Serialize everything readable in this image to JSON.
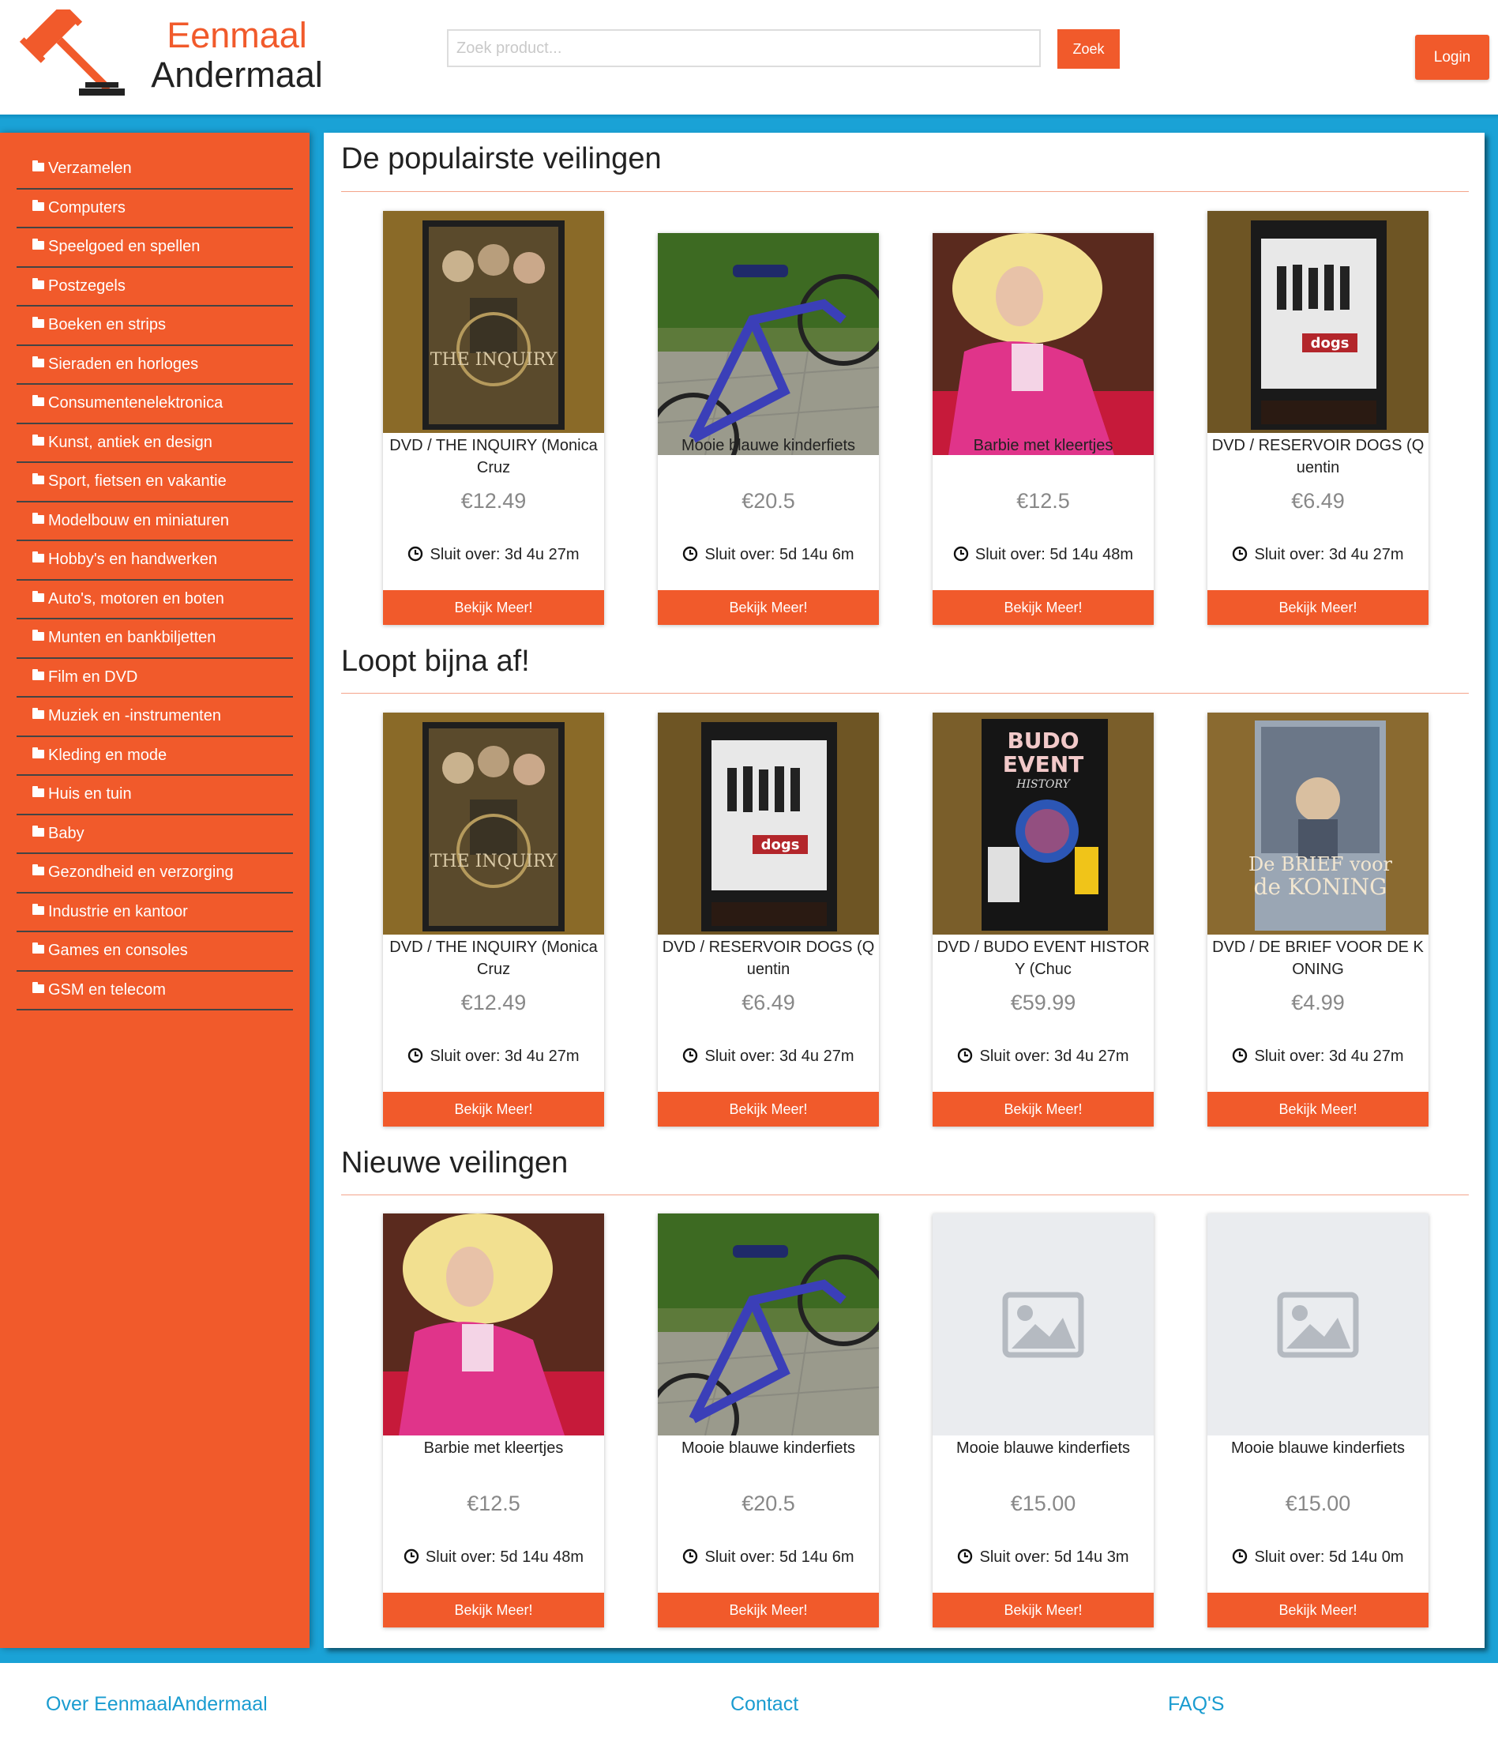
{
  "brand": {
    "line1": "Eenmaal",
    "line2": "Andermaal",
    "logo_icon": "gavel-icon"
  },
  "search": {
    "placeholder": "Zoek product...",
    "value": "",
    "button": "Zoek"
  },
  "login": "Login",
  "categories": [
    "Verzamelen",
    "Computers",
    "Speelgoed en spellen",
    "Postzegels",
    "Boeken en strips",
    "Sieraden en horloges",
    "Consumentenelektronica",
    "Kunst, antiek en design",
    "Sport, fietsen en vakantie",
    "Modelbouw en miniaturen",
    "Hobby's en handwerken",
    "Auto's, motoren en boten",
    "Munten en bankbiljetten",
    "Film en DVD",
    "Muziek en -instrumenten",
    "Kleding en mode",
    "Huis en tuin",
    "Baby",
    "Gezondheid en verzorging",
    "Industrie en kantoor",
    "Games en consoles",
    "GSM en telecom"
  ],
  "sections": [
    {
      "title": "De populairste veilingen",
      "cards": [
        {
          "title": "DVD / THE INQUIRY (Monica Cruz",
          "price": "€12.49",
          "close_label": "Sluit over:",
          "close_time": "3d 4u 27m",
          "button": "Bekijk Meer!",
          "image": "dvd-inquiry"
        },
        {
          "title": "Mooie blauwe kinderfiets",
          "price": "€20.5",
          "close_label": "Sluit over:",
          "close_time": "5d 14u 6m",
          "button": "Bekijk Meer!",
          "image": "bike"
        },
        {
          "title": "Barbie met kleertjes",
          "price": "€12.5",
          "close_label": "Sluit over:",
          "close_time": "5d 14u 48m",
          "button": "Bekijk Meer!",
          "image": "barbie"
        },
        {
          "title": "DVD / RESERVOIR DOGS (Quentin",
          "price": "€6.49",
          "close_label": "Sluit over:",
          "close_time": "3d 4u 27m",
          "button": "Bekijk Meer!",
          "image": "dvd-reservoir"
        }
      ]
    },
    {
      "title": "Loopt bijna af!",
      "cards": [
        {
          "title": "DVD / THE INQUIRY (Monica Cruz",
          "price": "€12.49",
          "close_label": "Sluit over:",
          "close_time": "3d 4u 27m",
          "button": "Bekijk Meer!",
          "image": "dvd-inquiry"
        },
        {
          "title": "DVD / RESERVOIR DOGS (Quentin",
          "price": "€6.49",
          "close_label": "Sluit over:",
          "close_time": "3d 4u 27m",
          "button": "Bekijk Meer!",
          "image": "dvd-reservoir"
        },
        {
          "title": "DVD / BUDO EVENT HISTORY (Chuc",
          "price": "€59.99",
          "close_label": "Sluit over:",
          "close_time": "3d 4u 27m",
          "button": "Bekijk Meer!",
          "image": "dvd-budo"
        },
        {
          "title": "DVD / DE BRIEF VOOR DE KONING",
          "price": "€4.99",
          "close_label": "Sluit over:",
          "close_time": "3d 4u 27m",
          "button": "Bekijk Meer!",
          "image": "dvd-brief"
        }
      ]
    },
    {
      "title": "Nieuwe veilingen",
      "cards": [
        {
          "title": "Barbie met kleertjes",
          "price": "€12.5",
          "close_label": "Sluit over:",
          "close_time": "5d 14u 48m",
          "button": "Bekijk Meer!",
          "image": "barbie"
        },
        {
          "title": "Mooie blauwe kinderfiets",
          "price": "€20.5",
          "close_label": "Sluit over:",
          "close_time": "5d 14u 6m",
          "button": "Bekijk Meer!",
          "image": "bike"
        },
        {
          "title": "Mooie blauwe kinderfiets",
          "price": "€15.00",
          "close_label": "Sluit over:",
          "close_time": "5d 14u 3m",
          "button": "Bekijk Meer!",
          "image": "placeholder"
        },
        {
          "title": "Mooie blauwe kinderfiets",
          "price": "€15.00",
          "close_label": "Sluit over:",
          "close_time": "5d 14u 0m",
          "button": "Bekijk Meer!",
          "image": "placeholder"
        }
      ]
    }
  ],
  "footer": {
    "about": "Over EenmaalAndermaal",
    "contact": "Contact",
    "faq": "FAQ'S"
  },
  "colors": {
    "accent": "#f15a2b",
    "blue": "#1a9cd0",
    "link": "#1a9cd0"
  }
}
